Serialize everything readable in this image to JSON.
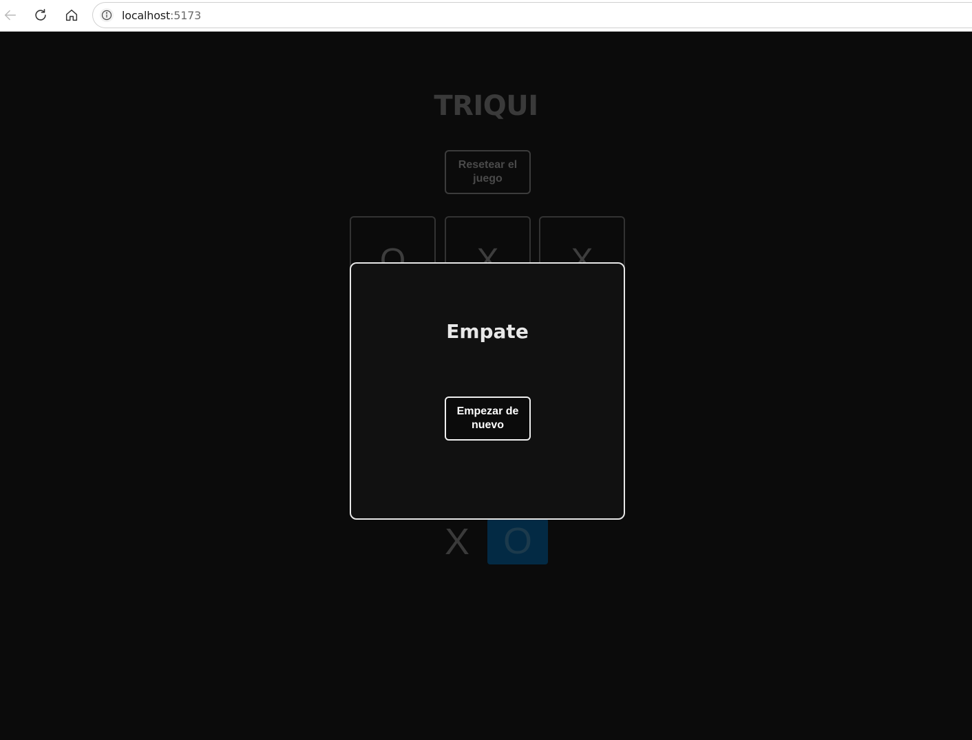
{
  "browser": {
    "url_host": "localhost",
    "url_port": ":5173",
    "icons": [
      "back-arrow-icon",
      "reload-icon",
      "home-icon",
      "info-icon"
    ]
  },
  "app": {
    "title": "TRIQUI",
    "reset_label": "Resetear el juego"
  },
  "board": {
    "cells": [
      "O",
      "X",
      "X"
    ]
  },
  "turn": {
    "x_label": "X",
    "o_label": "O",
    "active": "O",
    "active_color": "#032a44"
  },
  "modal": {
    "title": "Empate",
    "button_label": "Empezar de nuevo"
  }
}
